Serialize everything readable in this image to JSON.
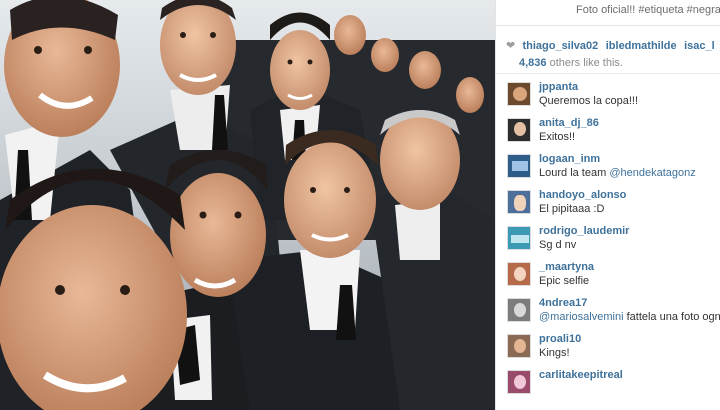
{
  "post": {
    "caption": "Foto oficial!! #etiqueta #negra",
    "photo_alt": "Team selfie in black suits"
  },
  "likes": {
    "likers": [
      "thiago_silva02",
      "ibledmathilde",
      "isac_l"
    ],
    "others_count": "4,836",
    "others_suffix": "others like this.",
    "icon": "heart-icon"
  },
  "comments": [
    {
      "user": "jppanta",
      "text": "Queremos la copa!!!",
      "avatar_color": "#6b4a2e"
    },
    {
      "user": "anita_dj_86",
      "text": "Exitos!!",
      "avatar_color": "#2d2d2d"
    },
    {
      "user": "logaan_inm",
      "text_prefix": "Lourd la team ",
      "mention": "@hendekatagonz",
      "avatar_color": "#2f5d8a"
    },
    {
      "user": "handoyo_alonso",
      "text": "El pipitaaa :D",
      "avatar_color": "#4d6f9c"
    },
    {
      "user": "rodrigo_laudemir",
      "text": "Sg d nv",
      "avatar_color": "#3c9ab5"
    },
    {
      "user": "_maartyna",
      "text": "Epic selfie",
      "avatar_color": "#b56b4a"
    },
    {
      "user": "4ndrea17",
      "mention": "@mariosalvemini",
      "text_suffix": " fattela una foto ogn",
      "avatar_color": "#7c7c7c"
    },
    {
      "user": "proali10",
      "text": "Kings!",
      "avatar_color": "#8a6a55"
    },
    {
      "user": "carlitakeepitreal",
      "text": "",
      "avatar_color": "#9a4a6a"
    }
  ],
  "colors": {
    "username": "#3f729b",
    "body_text": "#333333",
    "muted": "#8b8b8b"
  }
}
